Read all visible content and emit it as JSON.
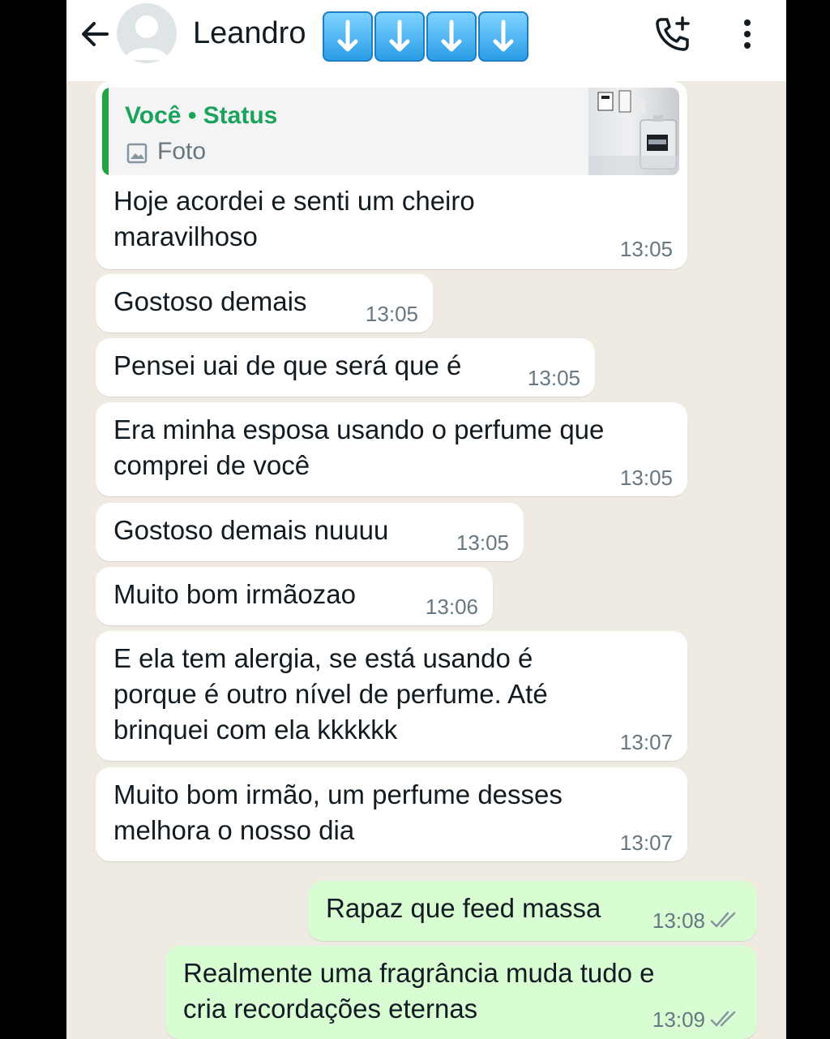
{
  "header": {
    "contact_name": "Leandro",
    "arrow_emoji_count": 4
  },
  "quoted": {
    "title": "Você • Status",
    "subtitle": "Foto"
  },
  "messages": [
    {
      "text": "Hoje acordei e senti um cheiro\nmaravilhoso",
      "time": "13:05",
      "direction": "in"
    },
    {
      "text": "Gostoso demais",
      "time": "13:05",
      "direction": "in"
    },
    {
      "text": "Pensei uai de que será que é",
      "time": "13:05",
      "direction": "in"
    },
    {
      "text": "Era minha esposa usando o perfume que\ncomprei de você",
      "time": "13:05",
      "direction": "in"
    },
    {
      "text": "Gostoso demais nuuuu",
      "time": "13:05",
      "direction": "in"
    },
    {
      "text": "Muito bom irmãozao",
      "time": "13:06",
      "direction": "in"
    },
    {
      "text": "E ela tem alergia, se está usando é\nporque é outro nível de perfume. Até\nbrinquei com ela kkkkkk",
      "time": "13:07",
      "direction": "in"
    },
    {
      "text": "Muito bom irmão, um perfume desses\nmelhora o nosso dia",
      "time": "13:07",
      "direction": "in"
    },
    {
      "text": "Rapaz que feed massa",
      "time": "13:08",
      "direction": "out",
      "status": "read"
    },
    {
      "text": "Realmente uma fragrância muda tudo e\ncria recordações eternas",
      "time": "13:09",
      "direction": "out",
      "status": "read"
    }
  ],
  "colors": {
    "background": "#efeae2",
    "incoming_bubble": "#ffffff",
    "outgoing_bubble": "#d9fdd3",
    "quote_accent": "#25a244"
  },
  "icons": [
    "back-arrow-icon",
    "avatar-placeholder-icon",
    "arrow-down-emoji-icon",
    "add-call-icon",
    "more-options-icon",
    "photo-icon",
    "double-check-icon"
  ]
}
